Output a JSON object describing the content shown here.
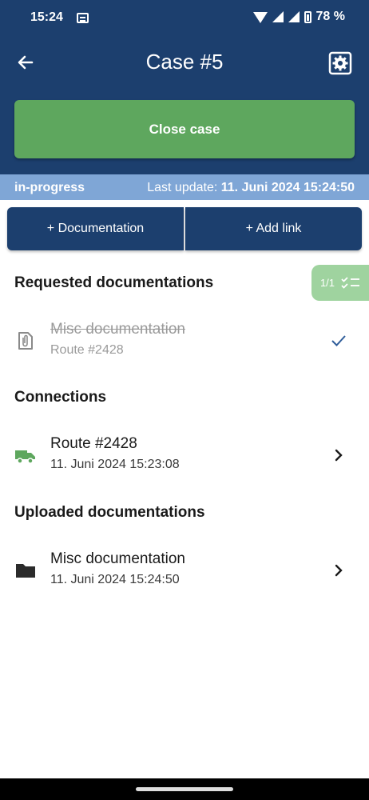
{
  "status_bar": {
    "time": "15:24",
    "battery": "78 %"
  },
  "header": {
    "title": "Case #5",
    "back_icon": "arrow-left-icon",
    "settings_icon": "gear-icon",
    "close_label": "Close case"
  },
  "case_status": {
    "state": "in-progress",
    "last_update_label": "Last update:",
    "last_update_value": "11. Juni 2024 15:24:50"
  },
  "actions": {
    "documentation": "+ Documentation",
    "add_link": "+ Add link"
  },
  "requested": {
    "title": "Requested documentations",
    "progress": "1/1",
    "items": [
      {
        "title": "Misc documentation",
        "subtitle": "Route #2428",
        "done": true,
        "icon": "paperclip-file-icon"
      }
    ]
  },
  "connections": {
    "title": "Connections",
    "items": [
      {
        "title": "Route #2428",
        "subtitle": "11. Juni 2024 15:23:08",
        "icon": "truck-icon"
      }
    ]
  },
  "uploaded": {
    "title": "Uploaded documentations",
    "items": [
      {
        "title": "Misc documentation",
        "subtitle": "11. Juni 2024 15:24:50",
        "icon": "folder-icon"
      }
    ]
  },
  "colors": {
    "primary": "#1c3f6e",
    "success": "#5ea75e",
    "status_strip": "#7fa6d6",
    "check": "#2f5d9a"
  }
}
